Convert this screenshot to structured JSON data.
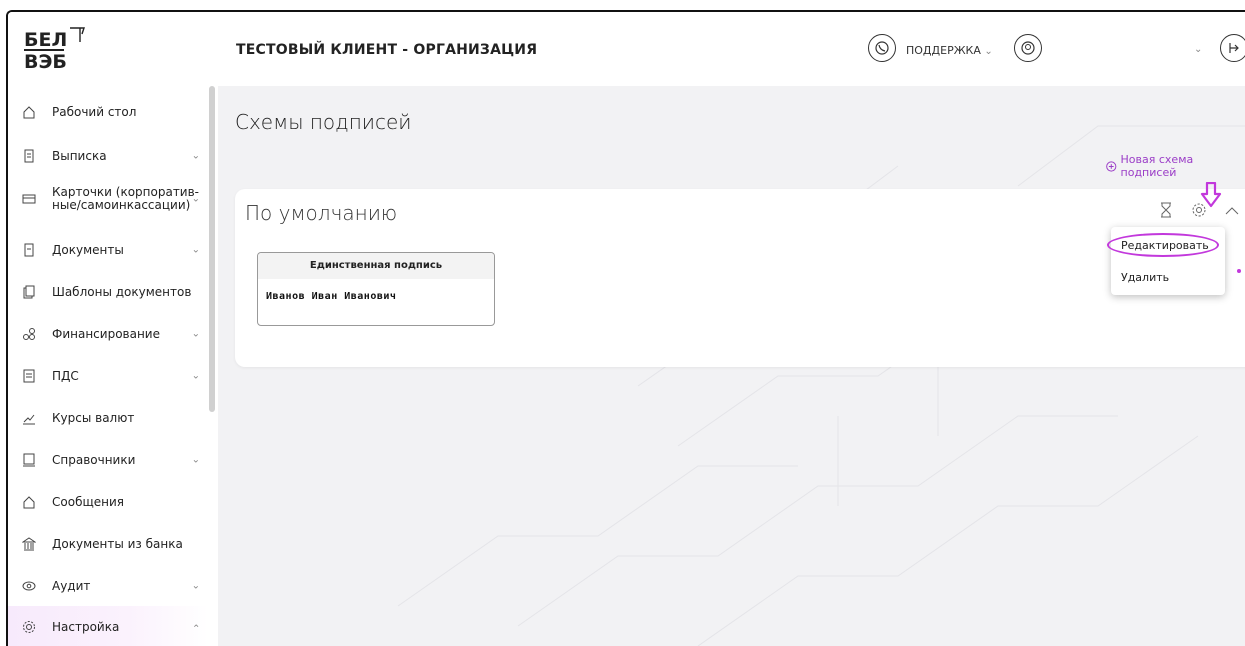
{
  "header": {
    "org_name": "ТЕСТОВЫЙ КЛИЕНТ - ОРГАНИЗАЦИЯ",
    "support_label": "ПОДДЕРЖКА",
    "logo_top": "БЕЛ",
    "logo_bottom": "ВЭБ"
  },
  "sidebar": {
    "items": [
      {
        "label": "Рабочий стол",
        "icon": "home-icon"
      },
      {
        "label": "Выписка",
        "icon": "document-icon"
      },
      {
        "label": "Карточки (корпоратив-ные/самоинкассации)",
        "icon": "card-icon"
      },
      {
        "label": "Документы",
        "icon": "document-icon"
      },
      {
        "label": "Шаблоны документов",
        "icon": "template-icon"
      },
      {
        "label": "Финансирование",
        "icon": "finance-icon"
      },
      {
        "label": "ПДС",
        "icon": "pds-icon"
      },
      {
        "label": "Курсы валют",
        "icon": "chart-icon"
      },
      {
        "label": "Справочники",
        "icon": "book-icon"
      },
      {
        "label": "Сообщения",
        "icon": "message-icon"
      },
      {
        "label": "Документы из банка",
        "icon": "bank-icon"
      },
      {
        "label": "Аудит",
        "icon": "eye-icon"
      },
      {
        "label": "Настройка",
        "icon": "gear-icon"
      }
    ]
  },
  "main": {
    "page_title": "Схемы подписей",
    "new_scheme_link": "Новая схема подписей",
    "card": {
      "title": "По умолчанию",
      "signature_box": {
        "header": "Единственная подпись",
        "name": "Иванов Иван Иванович"
      }
    },
    "context_menu": {
      "edit": "Редактировать",
      "delete": "Удалить"
    }
  },
  "colors": {
    "accent": "#9b3dc7",
    "highlight": "#c238dc"
  }
}
